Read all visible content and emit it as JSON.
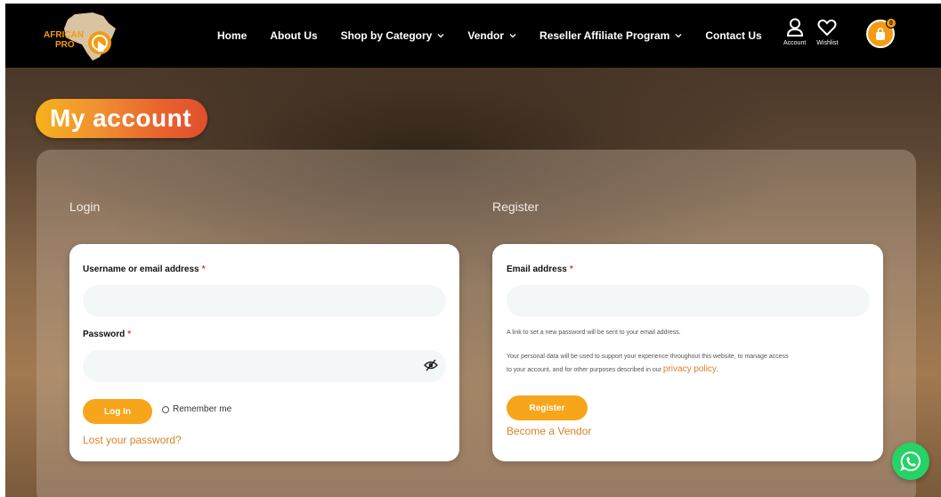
{
  "brand": {
    "logo_line1": "AFRICAN",
    "logo_line2": "PRO",
    "accent": "#f7a51b"
  },
  "nav": {
    "links": [
      {
        "label": "Home",
        "dropdown": false
      },
      {
        "label": "About Us",
        "dropdown": false
      },
      {
        "label": "Shop by Category",
        "dropdown": true
      },
      {
        "label": "Vendor",
        "dropdown": true
      },
      {
        "label": "Reseller Affiliate Program",
        "dropdown": true
      },
      {
        "label": "Contact Us",
        "dropdown": false
      }
    ],
    "account_label": "Account",
    "wishlist_label": "Wishlist",
    "cart_count": "0"
  },
  "page_title": "My account",
  "login": {
    "heading": "Login",
    "username_label": "Username or email address",
    "username_value": "",
    "password_label": "Password",
    "password_value": "",
    "required_mark": "*",
    "login_button": "Log In",
    "remember_label": "Remember me",
    "lost_password": "Lost your password?"
  },
  "register": {
    "heading": "Register",
    "email_label": "Email address",
    "email_value": "",
    "required_mark": "*",
    "password_note": "A link to set a new password will be sent to your email address.",
    "privacy_text_1": "Your personal data will be used to support your experience throughout this website, to manage access",
    "privacy_text_2": "to your account, and for other purposes described in our ",
    "privacy_link": "privacy policy.",
    "register_button": "Register",
    "become_vendor": "Become a Vendor"
  },
  "icons": [
    "user-icon",
    "heart-icon",
    "shopping-bag-icon",
    "eye-slash-icon",
    "whatsapp-icon",
    "chevron-down-icon"
  ]
}
